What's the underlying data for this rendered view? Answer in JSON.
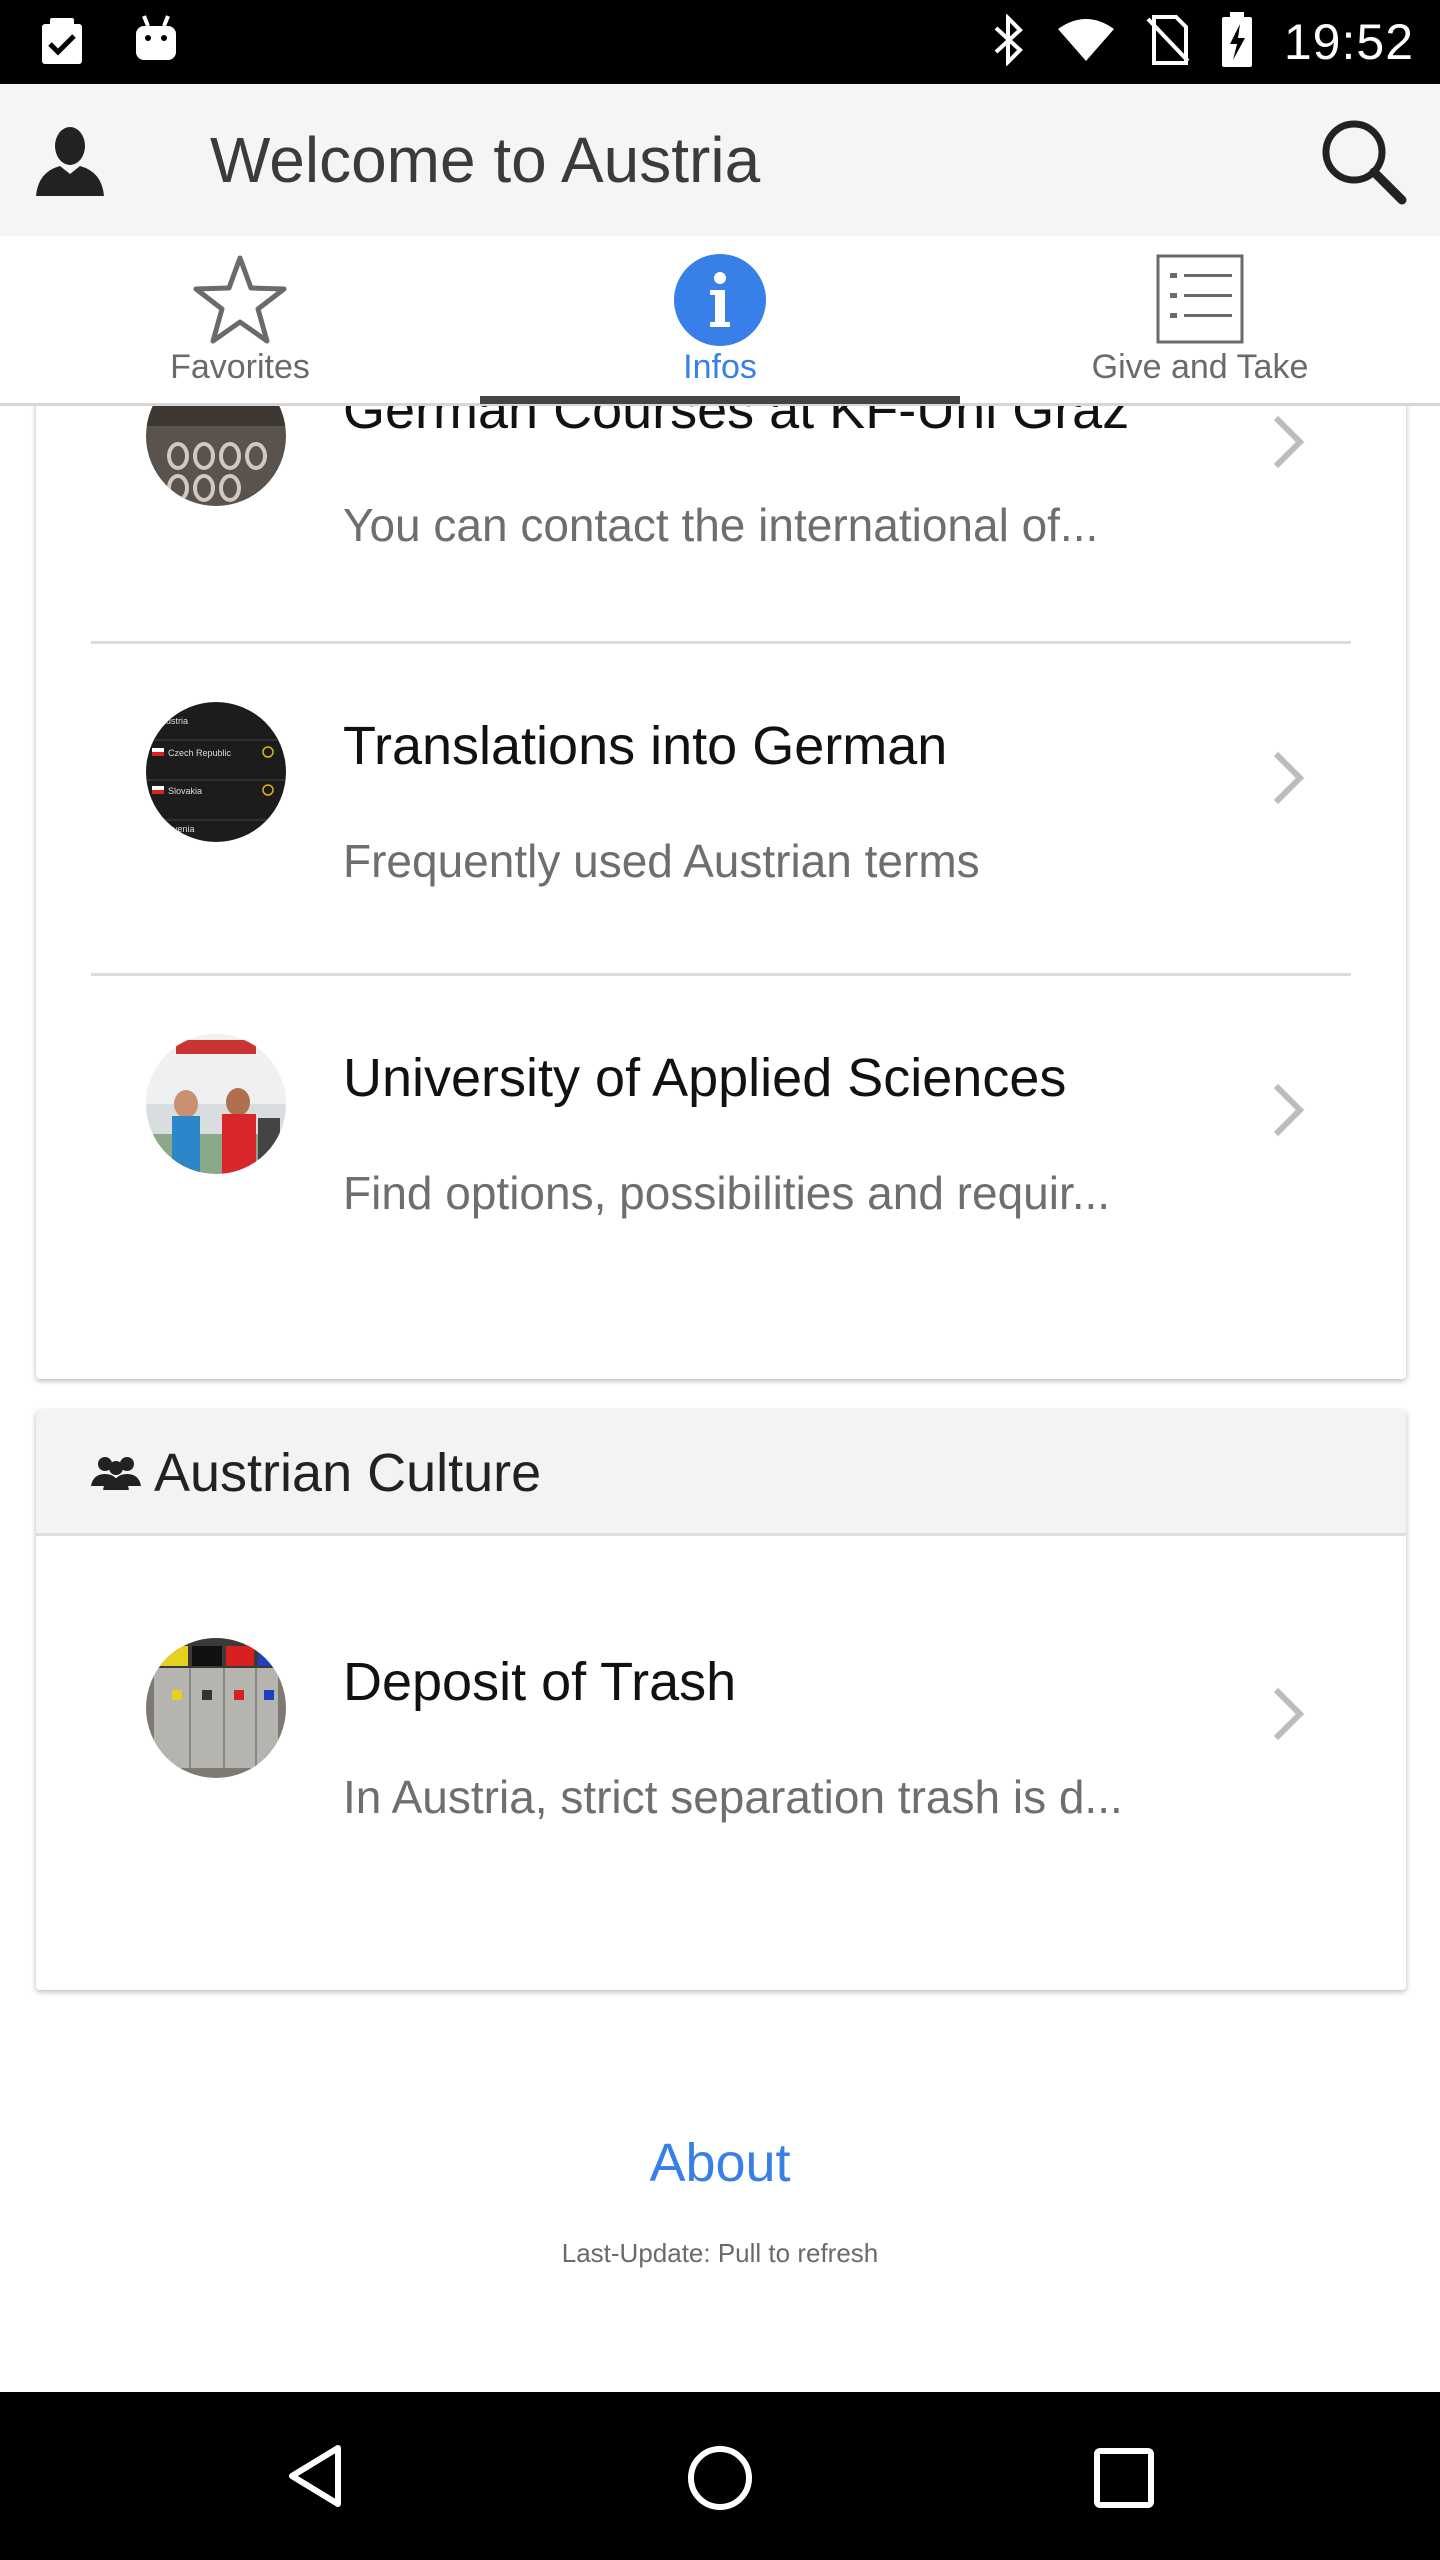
{
  "status_bar": {
    "time": "19:52",
    "left_icons": [
      "clipboard-check-icon",
      "android-icon"
    ],
    "right_icons": [
      "bluetooth-icon",
      "wifi-icon",
      "no-sim-icon",
      "battery-charging-icon"
    ]
  },
  "app_bar": {
    "title": "Welcome to Austria",
    "left_icon": "person-icon",
    "right_icon": "search-icon"
  },
  "tabs": [
    {
      "label": "Favorites",
      "icon": "star-icon",
      "active": false
    },
    {
      "label": "Infos",
      "icon": "info-icon",
      "active": true
    },
    {
      "label": "Give and Take",
      "icon": "list-icon",
      "active": false
    }
  ],
  "info_items": [
    {
      "title": "German Courses at KF-Uni Graz",
      "subtitle": "You can contact the international of..."
    },
    {
      "title": "Translations into German",
      "subtitle": "Frequently used Austrian terms"
    },
    {
      "title": "University of Applied Sciences",
      "subtitle": "Find options, possibilities and requir..."
    }
  ],
  "culture_section": {
    "header": "Austrian Culture",
    "header_icon": "group-icon",
    "items": [
      {
        "title": "Deposit of Trash",
        "subtitle": "In Austria, strict separation trash is d..."
      }
    ]
  },
  "thumb_texts": [
    "Austria",
    "Czech Republic",
    "Slovakia",
    "Slovenia"
  ],
  "footer": {
    "about": "About",
    "last_update": "Last-Update: Pull to refresh"
  },
  "colors": {
    "accent": "#3880e8",
    "tab_indicator": "#444444",
    "appbar_bg": "#f5f5f5"
  }
}
